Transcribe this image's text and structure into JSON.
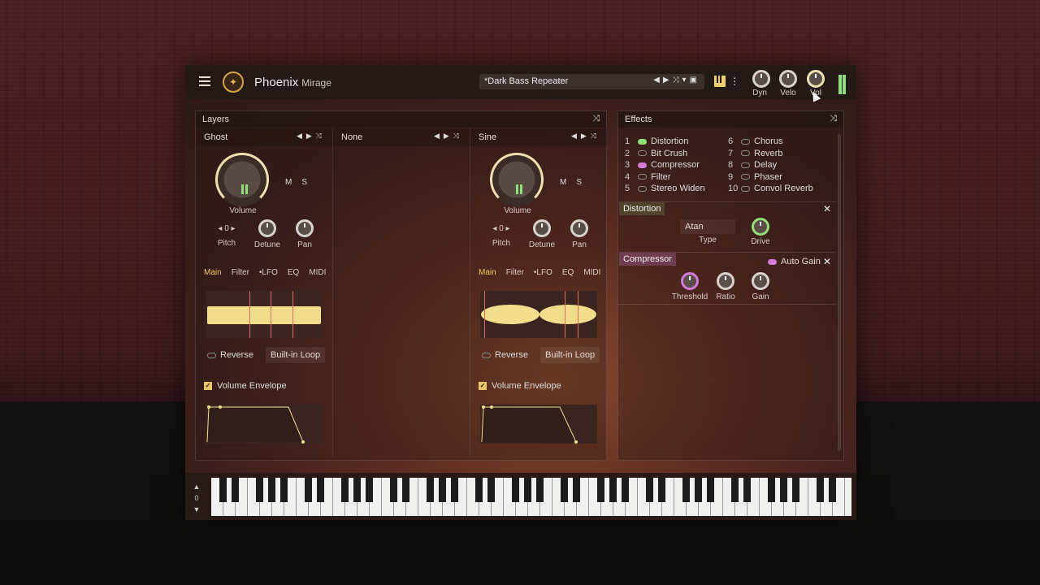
{
  "app": {
    "name": "Phoenix",
    "sub": "Mirage"
  },
  "preset": {
    "name": "*Dark Bass Repeater"
  },
  "top_knobs": [
    "Dyn",
    "Velo",
    "Vol"
  ],
  "layers": {
    "title": "Layers",
    "cols": [
      {
        "name": "Ghost",
        "volume_label": "Volume",
        "pitch_value": "0",
        "pitch_label": "Pitch",
        "detune_label": "Detune",
        "pan_label": "Pan",
        "m": "M",
        "s": "S"
      },
      {
        "name": "None"
      },
      {
        "name": "Sine",
        "volume_label": "Volume",
        "pitch_value": "0",
        "pitch_label": "Pitch",
        "detune_label": "Detune",
        "pan_label": "Pan",
        "m": "M",
        "s": "S"
      }
    ],
    "tabs": [
      "Main",
      "Filter",
      "•LFO",
      "EQ",
      "MIDI"
    ],
    "reverse_label": "Reverse",
    "builtin_loop_label": "Built-in Loop",
    "volume_envelope_label": "Volume Envelope"
  },
  "effects": {
    "title": "Effects",
    "list_left": [
      {
        "n": "1",
        "name": "Distortion",
        "on": true,
        "color": "#8fe07a"
      },
      {
        "n": "2",
        "name": "Bit Crush",
        "on": false
      },
      {
        "n": "3",
        "name": "Compressor",
        "on": true,
        "color": "#d47ad8"
      },
      {
        "n": "4",
        "name": "Filter",
        "on": false
      },
      {
        "n": "5",
        "name": "Stereo Widen",
        "on": false
      }
    ],
    "list_right": [
      {
        "n": "6",
        "name": "Chorus",
        "on": false
      },
      {
        "n": "7",
        "name": "Reverb",
        "on": false
      },
      {
        "n": "8",
        "name": "Delay",
        "on": false
      },
      {
        "n": "9",
        "name": "Phaser",
        "on": false
      },
      {
        "n": "10",
        "name": "Convol Reverb",
        "on": false
      }
    ],
    "distortion": {
      "title": "Distortion",
      "type_value": "Atan",
      "type_label": "Type",
      "drive_label": "Drive"
    },
    "compressor": {
      "title": "Compressor",
      "auto_gain_label": "Auto Gain",
      "threshold_label": "Threshold",
      "ratio_label": "Ratio",
      "gain_label": "Gain"
    }
  },
  "keyboard": {
    "octave": "0"
  }
}
